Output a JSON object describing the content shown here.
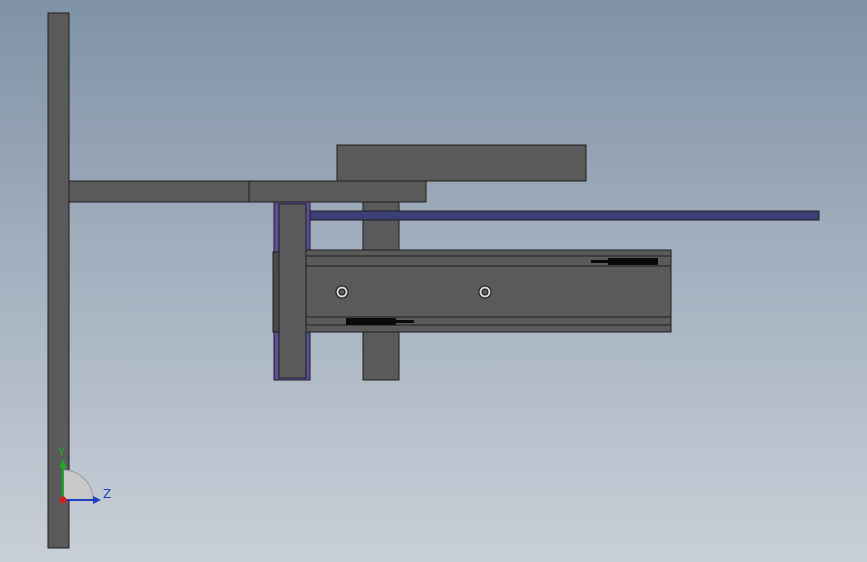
{
  "viewport": {
    "background_top": "#7f92a6",
    "background_bottom": "#c9cfd8"
  },
  "model": {
    "part_fill": "#5a5a5a",
    "part_stroke": "#1e1e1e",
    "rod_color": "#3a3f78",
    "plate_edge_color": "#5b4f96",
    "slot_color": "#0a0a0a"
  },
  "triad": {
    "y_label": "Y",
    "z_label": "Z",
    "y_color": "#1faa2a",
    "z_color": "#1f3fbf",
    "x_color": "#d01f1f"
  }
}
